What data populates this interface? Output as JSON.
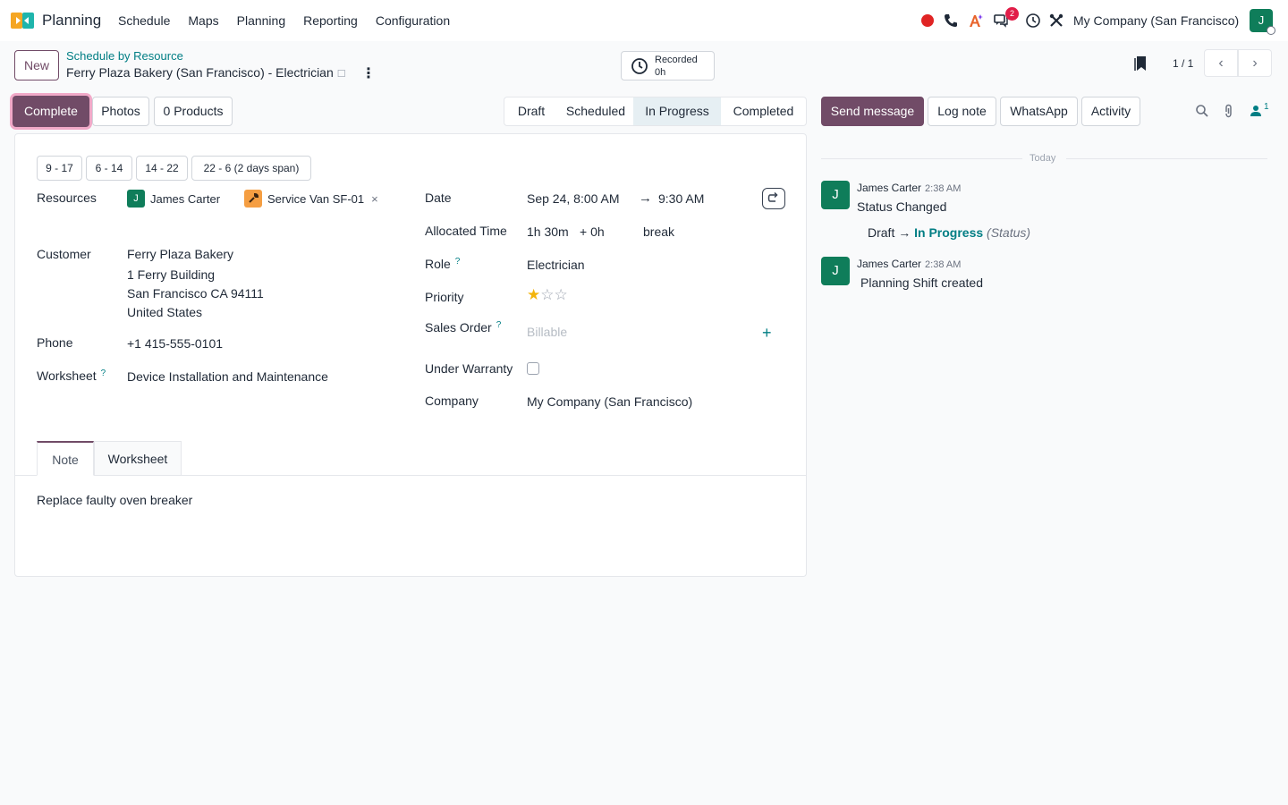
{
  "navbar": {
    "app_name": "Planning",
    "menu": [
      "Schedule",
      "Maps",
      "Planning",
      "Reporting",
      "Configuration"
    ],
    "company": "My Company (San Francisco)",
    "user_initial": "J",
    "messages_badge": "2"
  },
  "control": {
    "new_label": "New",
    "breadcrumb": "Schedule by Resource",
    "title": "Ferry Plaza Bakery (San Francisco) - Electrician",
    "recorded_label": "Recorded",
    "recorded_value": "0h",
    "pager": "1 / 1"
  },
  "actions": {
    "complete": "Complete",
    "photos": "Photos",
    "products": "0 Products"
  },
  "statusbar": {
    "stages": [
      "Draft",
      "Scheduled",
      "In Progress",
      "Completed"
    ],
    "active": "In Progress"
  },
  "chatter_buttons": {
    "send_message": "Send message",
    "log_note": "Log note",
    "whatsapp": "WhatsApp",
    "activity": "Activity",
    "followers_count": "1"
  },
  "form": {
    "shift_templates": [
      "9 - 17",
      "6 - 14",
      "14 - 22",
      "22 - 6 (2 days span)"
    ],
    "resources_label": "Resources",
    "resources": [
      {
        "initial": "J",
        "name": "James Carter"
      },
      {
        "name": "Service Van SF-01"
      }
    ],
    "customer_label": "Customer",
    "customer_lines": [
      "Ferry Plaza Bakery",
      "1 Ferry Building",
      "San Francisco CA 94111",
      "United States"
    ],
    "phone_label": "Phone",
    "phone": "+1 415-555-0101",
    "worksheet_label": "Worksheet",
    "worksheet": "Device Installation and Maintenance",
    "date_label": "Date",
    "date_start": "Sep 24, 8:00 AM",
    "date_end": "9:30 AM",
    "allocated_label": "Allocated Time",
    "allocated_time": "1h 30m",
    "allocated_extra": "+ 0h",
    "allocated_break": "break",
    "role_label": "Role",
    "role": "Electrician",
    "priority_label": "Priority",
    "priority_stars": 1,
    "priority_max": 3,
    "sales_order_label": "Sales Order",
    "sales_order_placeholder": "Billable",
    "warranty_label": "Under Warranty",
    "warranty_checked": false,
    "company_label": "Company",
    "company": "My Company (San Francisco)",
    "help_mark": "?",
    "tabs": [
      "Note",
      "Worksheet"
    ],
    "note": "Replace faulty oven breaker"
  },
  "chatter": {
    "today": "Today",
    "messages": [
      {
        "initial": "J",
        "author": "James Carter",
        "time": "2:38 AM",
        "title": "Status Changed",
        "from": "Draft",
        "arrow": "→",
        "to": "In Progress",
        "field": "(Status)"
      },
      {
        "initial": "J",
        "author": "James Carter",
        "time": "2:38 AM",
        "body": "Planning Shift created"
      }
    ]
  },
  "colors": {
    "primary": "#714b67",
    "teal": "#017e84",
    "avatar": "#0f7d5a"
  }
}
